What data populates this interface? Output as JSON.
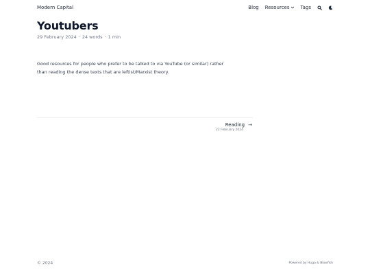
{
  "header": {
    "site_title": "Modern Capital",
    "nav": {
      "blog": "Blog",
      "resources": "Resources",
      "tags": "Tags"
    },
    "icons": {
      "search": "search-icon",
      "theme": "moon-icon",
      "dropdown": "chevron-down-icon"
    }
  },
  "article": {
    "title": "Youtubers",
    "date": "29 February 2024",
    "separator": "·",
    "word_count": "24 words",
    "read_time": "1 min",
    "body": "Good resources for people who prefer to be talked to via YouTube (or similar) rather than reading the dense texts that are leftist/Marxist theory."
  },
  "pagination": {
    "next_title": "Reading",
    "next_arrow": "→",
    "next_date": "22 February 2024"
  },
  "footer": {
    "copyright": "© 2024",
    "powered_by": "Powered by Hugo & Blowfish"
  },
  "colors": {
    "background": "#ffffff",
    "text": "#1f2937",
    "muted": "#6b7280",
    "title": "#0f172a"
  }
}
